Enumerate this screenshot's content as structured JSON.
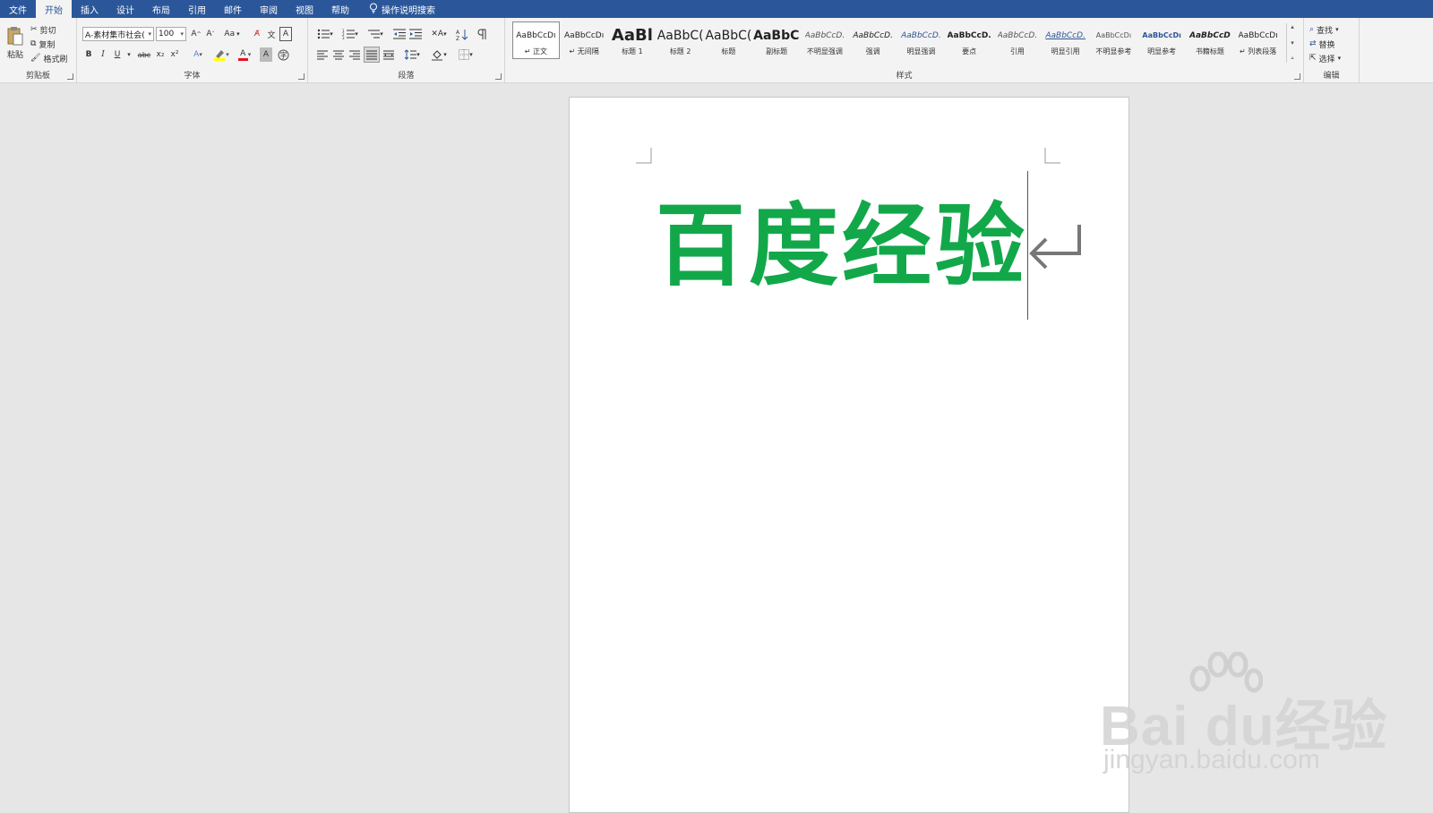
{
  "menu": {
    "tabs": [
      "文件",
      "开始",
      "插入",
      "设计",
      "布局",
      "引用",
      "邮件",
      "审阅",
      "视图",
      "帮助"
    ],
    "active_tab": "开始",
    "tell_me": "操作说明搜索"
  },
  "clipboard": {
    "paste": "粘贴",
    "cut": "剪切",
    "copy": "复制",
    "format_painter": "格式刷",
    "label": "剪贴板"
  },
  "font": {
    "font_name": "A-素材集市社会(",
    "font_size": "100",
    "change_case": "Aa",
    "bold": "B",
    "italic": "I",
    "underline": "U",
    "strikethrough": "abc",
    "subscript": "x₂",
    "superscript": "x²",
    "label": "字体",
    "highlight_color": "#ffff00",
    "font_color": "#e81123"
  },
  "paragraph": {
    "label": "段落"
  },
  "styles": {
    "label": "样式",
    "items": [
      {
        "sample": "AaBbCcDı",
        "name": "↵ 正文",
        "selected": true
      },
      {
        "sample": "AaBbCcDı",
        "name": "↵ 无间隔"
      },
      {
        "sample": "AaBl",
        "name": "标题 1"
      },
      {
        "sample": "AaBbC(",
        "name": "标题 2"
      },
      {
        "sample": "AaBbC(",
        "name": "标题"
      },
      {
        "sample": "AaBbC(",
        "name": "副标题"
      },
      {
        "sample": "AaBbCcD.",
        "name": "不明显强调"
      },
      {
        "sample": "AaBbCcD.",
        "name": "强调"
      },
      {
        "sample": "AaBbCcD.",
        "name": "明显强调"
      },
      {
        "sample": "AaBbCcD.",
        "name": "要点"
      },
      {
        "sample": "AaBbCcD.",
        "name": "引用"
      },
      {
        "sample": "AaBbCcD.",
        "name": "明显引用"
      },
      {
        "sample": "AaBbCcDı",
        "name": "不明显参考"
      },
      {
        "sample": "AaBbCcDı",
        "name": "明显参考"
      },
      {
        "sample": "AaBbCcD",
        "name": "书籍标题"
      },
      {
        "sample": "AaBbCcDı",
        "name": "↵ 列表段落"
      }
    ]
  },
  "editing": {
    "find": "查找",
    "replace": "替换",
    "select": "选择",
    "label": "编辑"
  },
  "document": {
    "text": "百度经验",
    "text_color": "#12a84a"
  },
  "watermark": {
    "logo": "Bai du经验",
    "url": "jingyan.baidu.com"
  }
}
